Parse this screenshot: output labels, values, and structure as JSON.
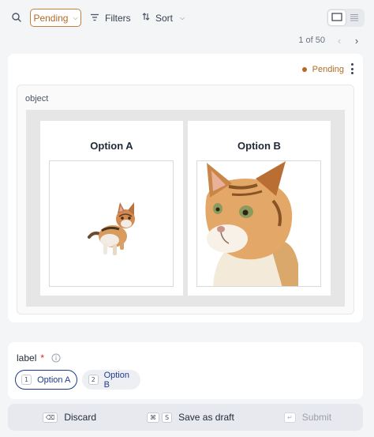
{
  "toolbar": {
    "status_filter_label": "Pending",
    "filters_label": "Filters",
    "sort_label": "Sort"
  },
  "pagination": {
    "text": "1 of 50",
    "prev": "‹",
    "next": "›"
  },
  "task": {
    "status": "Pending",
    "status_color": "#b46a26",
    "object_label": "object",
    "options": [
      {
        "title": "Option A",
        "image": "kitten-small-icon"
      },
      {
        "title": "Option B",
        "image": "kitten-closeup-icon"
      }
    ]
  },
  "label_section": {
    "title": "label",
    "required_mark": "*",
    "choices": [
      {
        "key": "1",
        "label": "Option A",
        "selected": true
      },
      {
        "key": "2",
        "label": "Option B",
        "selected": false
      }
    ]
  },
  "footer": {
    "discard_label": "Discard",
    "discard_key": "⌫",
    "draft_label": "Save as draft",
    "draft_key_1": "⌘",
    "draft_key_2": "S",
    "submit_label": "Submit",
    "submit_key": "↵"
  },
  "colors": {
    "accent": "#b46a26",
    "primary": "#1e3a8a",
    "required": "#dc2626"
  }
}
